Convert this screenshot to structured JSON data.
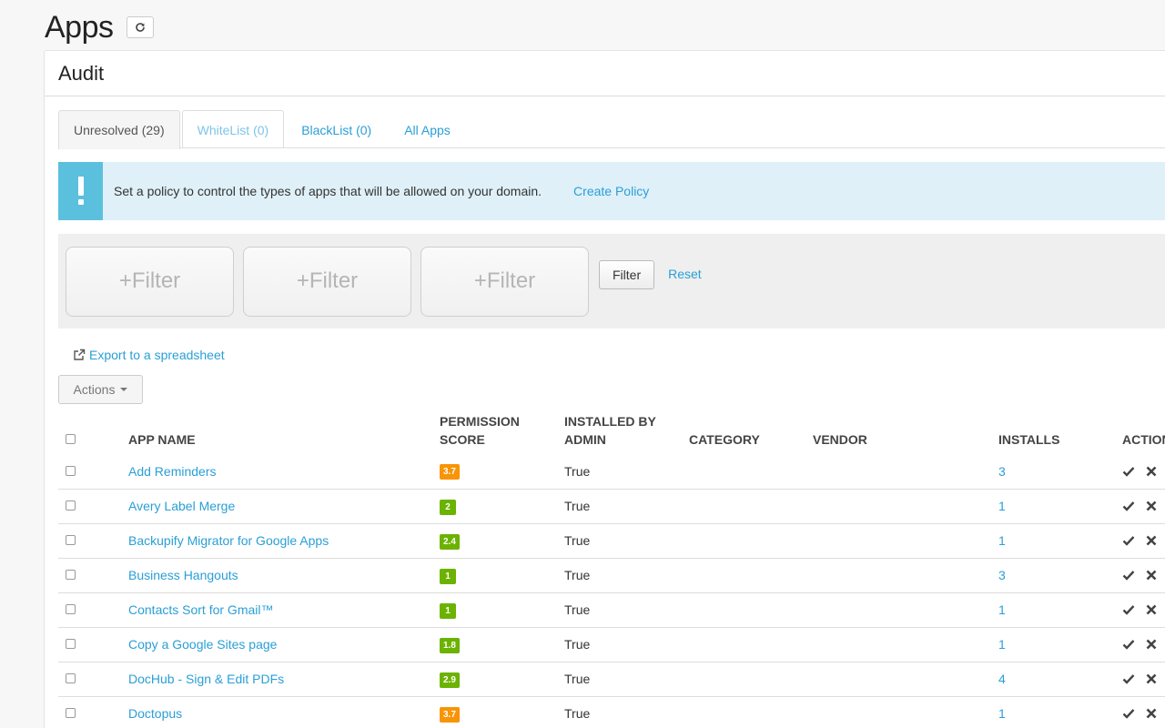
{
  "page": {
    "title": "Apps"
  },
  "card": {
    "title": "Audit"
  },
  "tabs": [
    {
      "label": "Unresolved (29)",
      "state": "active"
    },
    {
      "label": "WhiteList (0)",
      "state": "muted"
    },
    {
      "label": "BlackList (0)",
      "state": "normal"
    },
    {
      "label": "All Apps",
      "state": "normal"
    }
  ],
  "alert": {
    "text": "Set a policy to control the types of apps that will be allowed on your domain.",
    "link": "Create Policy"
  },
  "filters": {
    "boxes": [
      "+Filter",
      "+Filter",
      "+Filter"
    ],
    "button": "Filter",
    "reset": "Reset"
  },
  "export": {
    "label": "Export to a spreadsheet"
  },
  "actions": {
    "label": "Actions"
  },
  "table": {
    "headers": {
      "app_name": "APP NAME",
      "permission_score_1": "PERMISSION",
      "permission_score_2": "SCORE",
      "installed_by_1": "INSTALLED BY",
      "installed_by_2": "ADMIN",
      "category": "CATEGORY",
      "vendor": "VENDOR",
      "installs": "INSTALLS",
      "actions": "ACTIONS"
    },
    "rows": [
      {
        "name": "Add Reminders",
        "score": "3.7",
        "score_color": "#f89406",
        "admin": "True",
        "category": "",
        "vendor": "",
        "installs": "3"
      },
      {
        "name": "Avery Label Merge",
        "score": "2",
        "score_color": "#6cb200",
        "admin": "True",
        "category": "",
        "vendor": "",
        "installs": "1"
      },
      {
        "name": "Backupify Migrator for Google Apps",
        "score": "2.4",
        "score_color": "#6cb200",
        "admin": "True",
        "category": "",
        "vendor": "",
        "installs": "1"
      },
      {
        "name": "Business Hangouts",
        "score": "1",
        "score_color": "#6cb200",
        "admin": "True",
        "category": "",
        "vendor": "",
        "installs": "3"
      },
      {
        "name": "Contacts Sort for Gmail™",
        "score": "1",
        "score_color": "#6cb200",
        "admin": "True",
        "category": "",
        "vendor": "",
        "installs": "1"
      },
      {
        "name": "Copy a Google Sites page",
        "score": "1.8",
        "score_color": "#6cb200",
        "admin": "True",
        "category": "",
        "vendor": "",
        "installs": "1"
      },
      {
        "name": "DocHub - Sign & Edit PDFs",
        "score": "2.9",
        "score_color": "#6cb200",
        "admin": "True",
        "category": "",
        "vendor": "",
        "installs": "4"
      },
      {
        "name": "Doctopus",
        "score": "3.7",
        "score_color": "#f89406",
        "admin": "True",
        "category": "",
        "vendor": "",
        "installs": "1"
      }
    ]
  }
}
